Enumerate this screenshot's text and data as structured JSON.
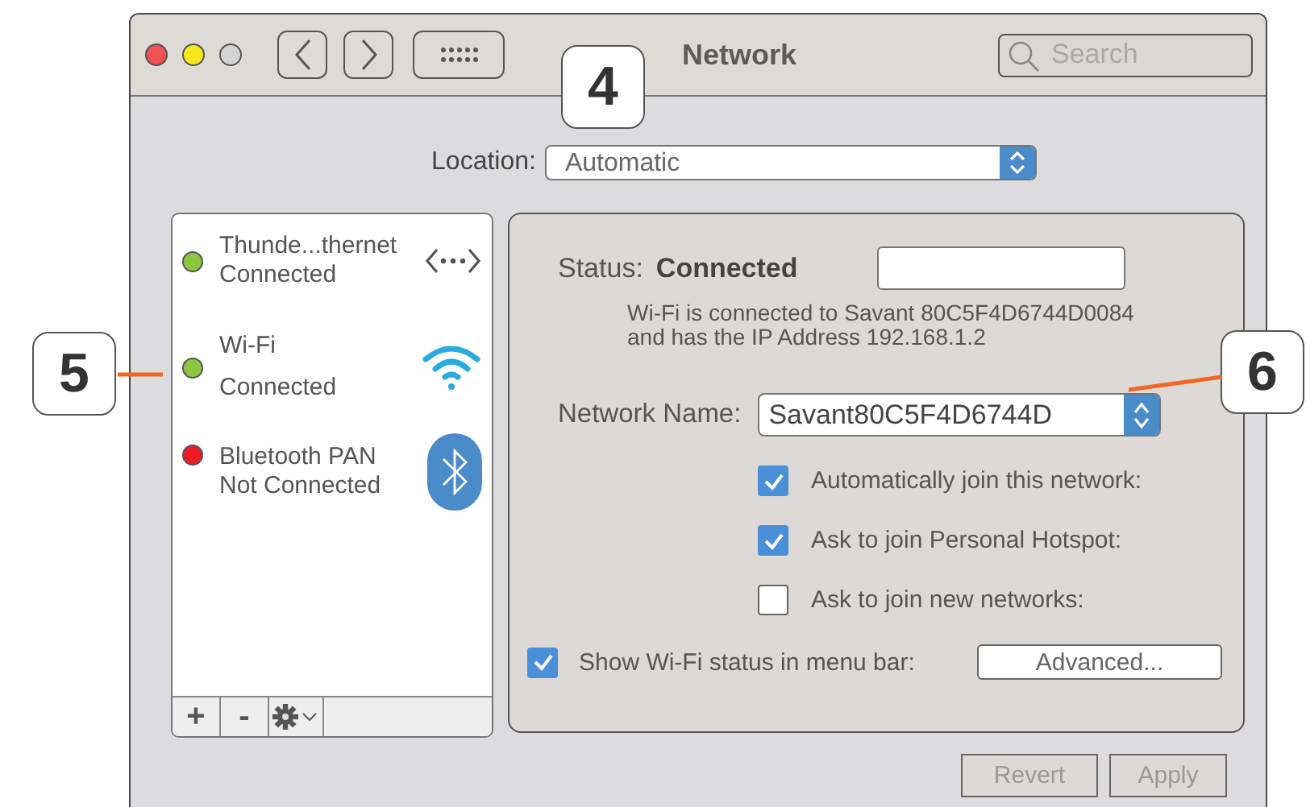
{
  "window": {
    "title": "Network",
    "search": {
      "placeholder": "Search"
    }
  },
  "location": {
    "label": "Location:",
    "value": "Automatic"
  },
  "services": [
    {
      "name": "Thunde...thernet",
      "status": "Connected",
      "color": "#8dc63f",
      "kind": "ethernet"
    },
    {
      "name": "Wi-Fi",
      "status": "Connected",
      "color": "#8dc63f",
      "kind": "wifi"
    },
    {
      "name": "Bluetooth PAN",
      "status": "Not Connected",
      "color": "#ed1c24",
      "kind": "bluetooth"
    }
  ],
  "list_toolbar": {
    "add": "+",
    "remove": "-"
  },
  "detail": {
    "status_label": "Status:",
    "status_value": "Connected",
    "description_lines": [
      "Wi-Fi is connected to Savant 80C5F4D6744D0084",
      "and has the IP Address 192.168.1.2"
    ],
    "network_name_label": "Network Name:",
    "network_name": "Savant80C5F4D6744D",
    "options": [
      {
        "label": "Automatically join this network:",
        "checked": true
      },
      {
        "label": "Ask to join Personal Hotspot:",
        "checked": true
      },
      {
        "label": "Ask to join new networks:",
        "checked": false
      }
    ],
    "show_status": {
      "label": "Show Wi-Fi status in menu bar:",
      "checked": true
    },
    "advanced_button": "Advanced..."
  },
  "buttons": [
    {
      "label": "Revert",
      "disabled": true
    },
    {
      "label": "Apply",
      "disabled": true
    }
  ],
  "callouts": [
    "4",
    "5",
    "6"
  ]
}
